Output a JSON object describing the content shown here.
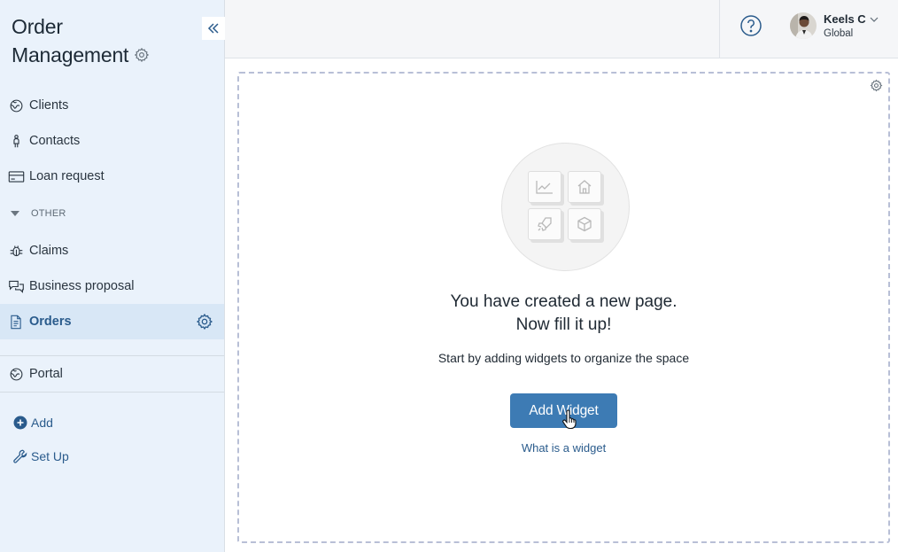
{
  "sidebar": {
    "app_title_line1": "Order",
    "app_title_line2": "Management",
    "nav": [
      {
        "label": "Clients",
        "icon": "globe-icon"
      },
      {
        "label": "Contacts",
        "icon": "person-icon"
      },
      {
        "label": "Loan request",
        "icon": "card-icon"
      }
    ],
    "section_label": "OTHER",
    "section_items": [
      {
        "label": "Claims",
        "icon": "bug-icon"
      },
      {
        "label": "Business proposal",
        "icon": "chat-icon"
      },
      {
        "label": "Orders",
        "icon": "document-icon",
        "active": true
      }
    ],
    "portal_label": "Portal",
    "add_label": "Add",
    "setup_label": "Set Up"
  },
  "topbar": {
    "user_name": "Keels C",
    "user_org": "Global"
  },
  "main": {
    "headline_line1": "You have created a new page.",
    "headline_line2": "Now fill it up!",
    "subline": "Start by adding widgets to organize the space",
    "add_widget_label": "Add Widget",
    "widget_link": "What is a widget"
  },
  "colors": {
    "accent": "#3d7bb4",
    "sidebar_bg": "#eaf2fb",
    "active_bg": "#d8e7f6",
    "link": "#2a5b8c"
  }
}
